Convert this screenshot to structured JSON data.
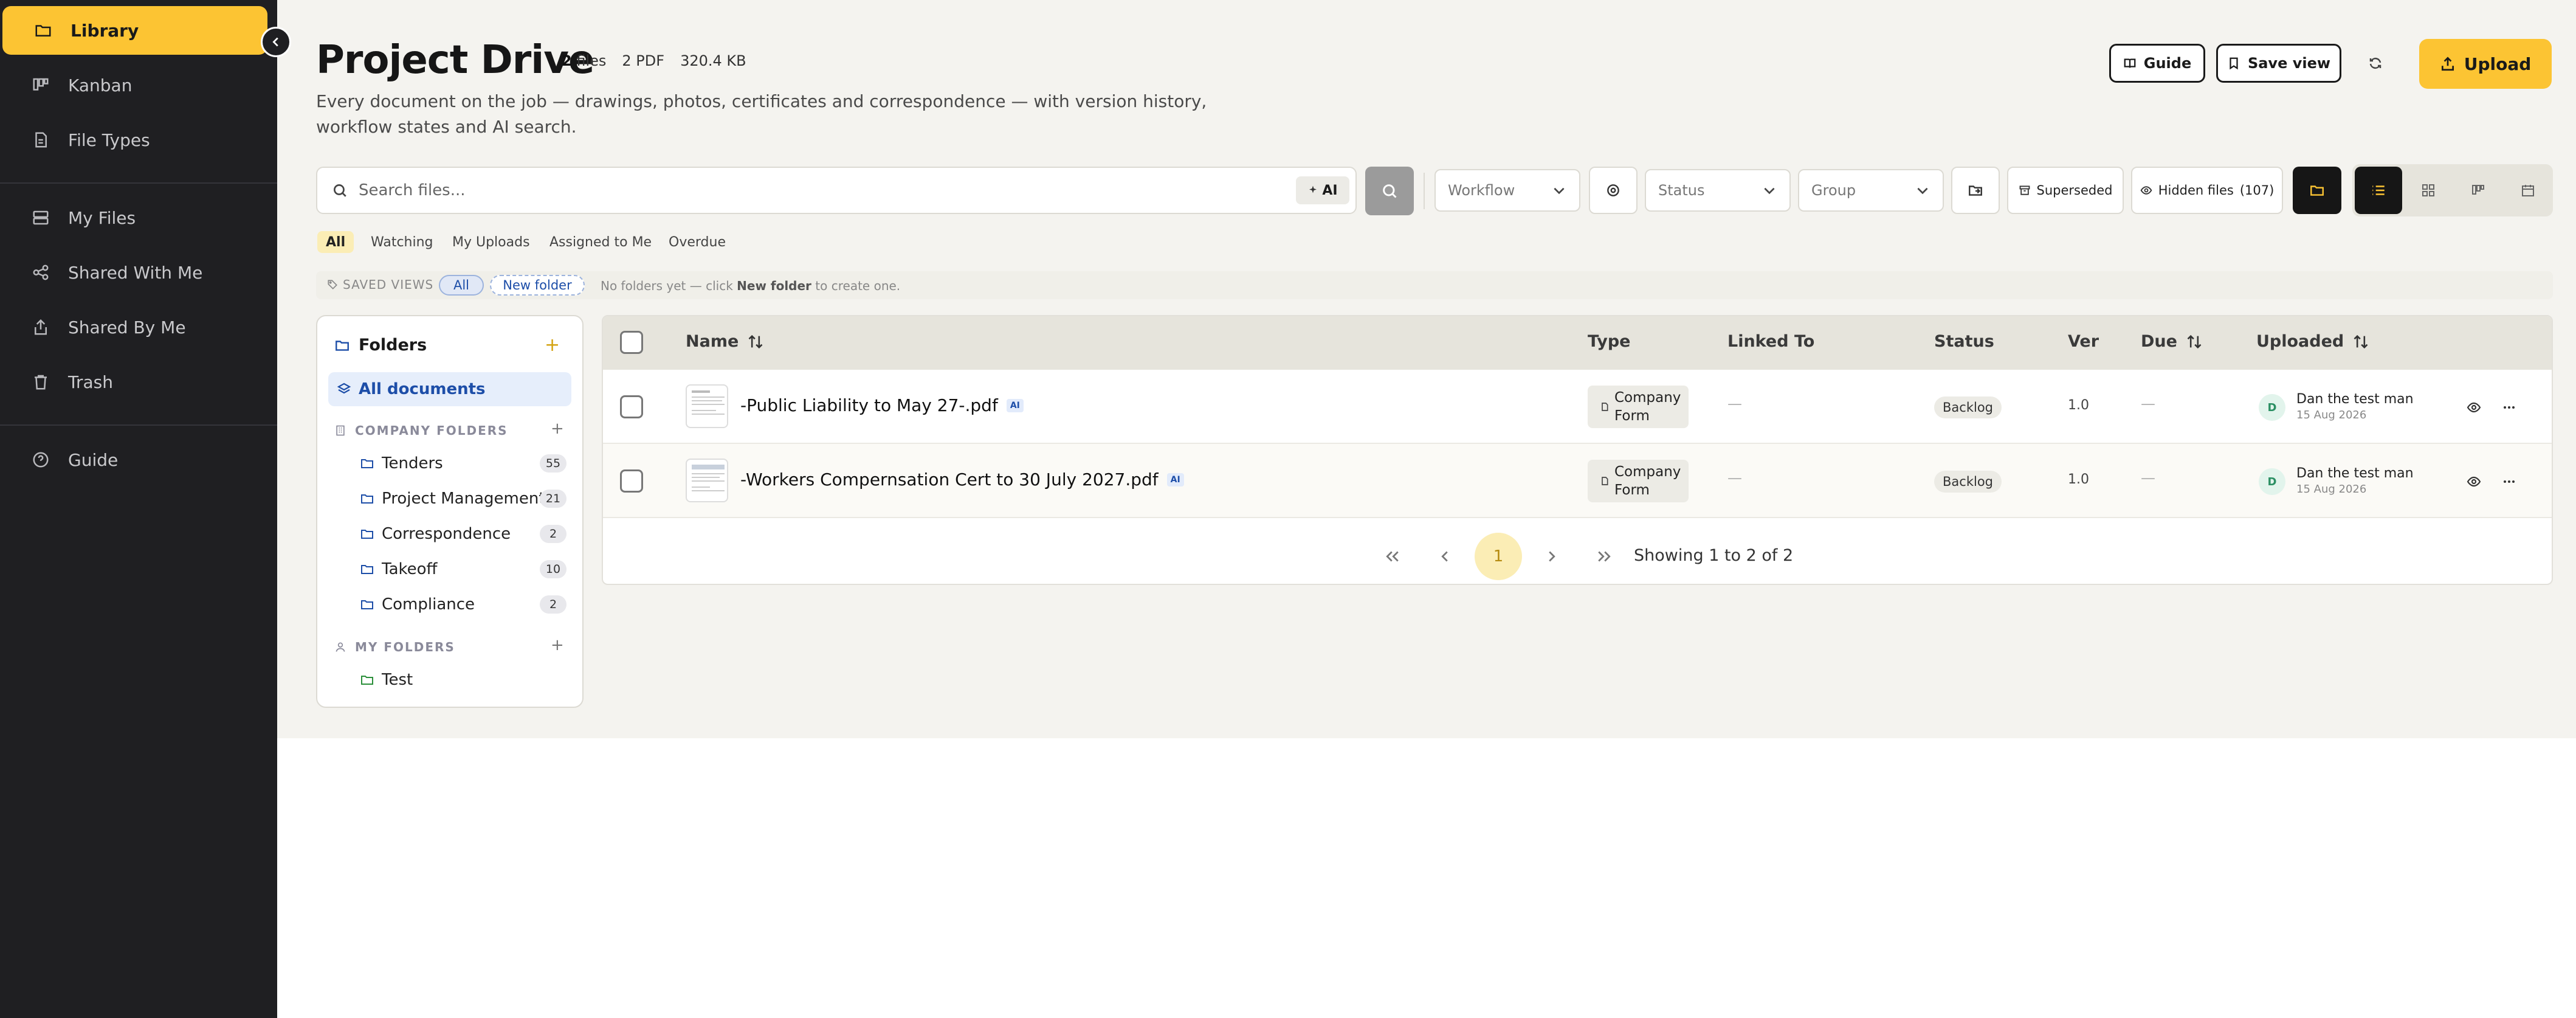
{
  "sidebar": {
    "items": [
      {
        "label": "Library"
      },
      {
        "label": "Kanban"
      },
      {
        "label": "File Types"
      },
      {
        "label": "My Files"
      },
      {
        "label": "Shared With Me"
      },
      {
        "label": "Shared By Me"
      },
      {
        "label": "Trash"
      },
      {
        "label": "Guide"
      }
    ]
  },
  "header": {
    "title": "Project Drive",
    "files_count": "2",
    "files_word": "files",
    "pdf_count": "2 PDF",
    "total_size": "320.4 KB",
    "subtitle": "Every document on the job — drawings, photos, certificates and correspondence — with version history, workflow states and AI search.",
    "guide_label": "Guide",
    "save_view_label": "Save view",
    "upload_label": "Upload"
  },
  "toolbar": {
    "search_placeholder": "Search files...",
    "ai_label": "AI",
    "workflow_placeholder": "Workflow",
    "status_placeholder": "Status",
    "group_placeholder": "Group",
    "superseded_label": "Superseded",
    "hidden_files_label": "Hidden files",
    "hidden_files_count": "(107)"
  },
  "filters": {
    "tabs": [
      {
        "label": "All"
      },
      {
        "label": "Watching"
      },
      {
        "label": "My Uploads"
      },
      {
        "label": "Assigned to Me"
      },
      {
        "label": "Overdue"
      }
    ]
  },
  "saved_views": {
    "label": "SAVED VIEWS",
    "all_label": "All",
    "new_folder_label": "New folder",
    "note_prefix": "No folders yet — click",
    "note_bold": "New folder",
    "note_suffix": "to create one."
  },
  "folders": {
    "title": "Folders",
    "all_documents": "All documents",
    "company_section": "COMPANY FOLDERS",
    "company": [
      {
        "name": "Tenders",
        "count": "55"
      },
      {
        "name": "Project Management",
        "count": "21"
      },
      {
        "name": "Correspondence",
        "count": "2"
      },
      {
        "name": "Takeoff",
        "count": "10"
      },
      {
        "name": "Compliance",
        "count": "2"
      }
    ],
    "my_section": "MY FOLDERS",
    "mine": [
      {
        "name": "Test"
      }
    ]
  },
  "table": {
    "columns": {
      "name": "Name",
      "type": "Type",
      "linked_to": "Linked To",
      "status": "Status",
      "ver": "Ver",
      "due": "Due",
      "uploaded": "Uploaded"
    },
    "rows": [
      {
        "name": "-Public Liability to May 27-.pdf",
        "ai": "AI",
        "type_line1": "Company",
        "type_line2": "Form",
        "linked_to": "—",
        "status": "Backlog",
        "ver": "1.0",
        "due": "—",
        "avatar": "D",
        "uploader": "Dan the test man",
        "uploaded_date": "15 Aug 2026"
      },
      {
        "name": "-Workers Compernsation Cert to 30 July 2027.pdf",
        "ai": "AI",
        "type_line1": "Company",
        "type_line2": "Form",
        "linked_to": "—",
        "status": "Backlog",
        "ver": "1.0",
        "due": "—",
        "avatar": "D",
        "uploader": "Dan the test man",
        "uploaded_date": "15 Aug 2026"
      }
    ]
  },
  "pagination": {
    "current_page": "1",
    "info": "Showing 1 to 2 of 2"
  },
  "colors": {
    "accent": "#fcc433",
    "sidebar_bg": "#1f1f22",
    "page_bg": "#f4f3ef",
    "link_blue": "#1d4ea8"
  }
}
